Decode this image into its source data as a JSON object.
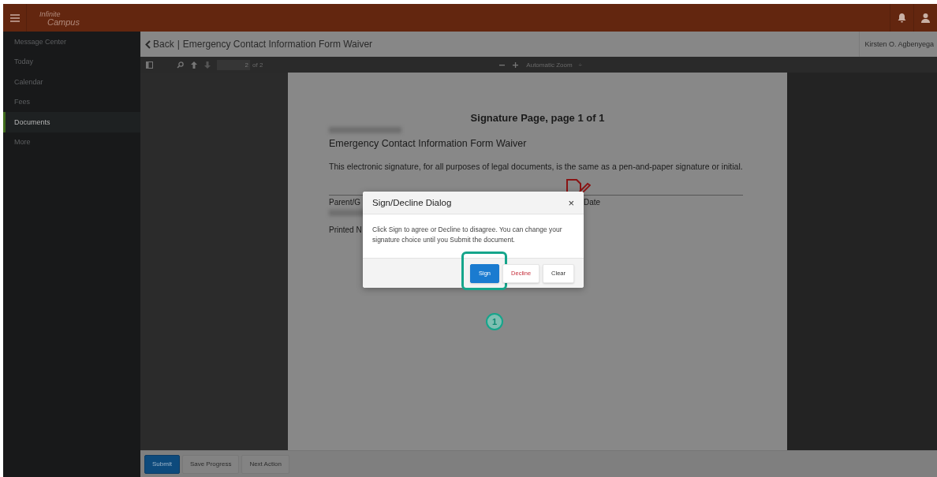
{
  "header": {
    "logo": {
      "line1": "Infinite",
      "line2": "Campus"
    }
  },
  "sidebar": {
    "items": [
      {
        "label": "Message Center",
        "selected": false
      },
      {
        "label": "Today",
        "selected": false
      },
      {
        "label": "Calendar",
        "selected": false
      },
      {
        "label": "Fees",
        "selected": false
      },
      {
        "label": "Documents",
        "selected": true
      },
      {
        "label": "More",
        "selected": false
      }
    ]
  },
  "title_bar": {
    "back": "Back",
    "separator": "|",
    "title": "Emergency Contact Information Form Waiver",
    "user": "Kirsten O. Agbenyega"
  },
  "pdf_toolbar": {
    "page": "2",
    "page_count": "of 2",
    "zoom": "Automatic Zoom",
    "zoom_caret": "÷"
  },
  "document": {
    "heading": "Signature Page, page 1 of 1",
    "form_title": "Emergency Contact Information Form Waiver",
    "statement": "This electronic signature, for all purposes of legal documents, is the same as a pen-and-paper signature or initial.",
    "signer_label": "Parent/G",
    "date_label": "Date",
    "printed_label": "Printed N"
  },
  "dialog": {
    "title": "Sign/Decline Dialog",
    "close": "×",
    "message": "Click Sign to agree or Decline to disagree. You can change your signature choice until you Submit the document.",
    "buttons": [
      {
        "label": "Sign",
        "kind": "primary",
        "highlighted": true
      },
      {
        "label": "Decline",
        "kind": "danger",
        "highlighted": false
      },
      {
        "label": "Clear",
        "kind": "plain",
        "highlighted": false
      }
    ]
  },
  "annotation": {
    "step": "1"
  },
  "footer": {
    "buttons": [
      {
        "label": "Submit",
        "kind": "primary"
      },
      {
        "label": "Save Progress",
        "kind": "plain"
      },
      {
        "label": "Next Action",
        "kind": "plain"
      }
    ]
  }
}
